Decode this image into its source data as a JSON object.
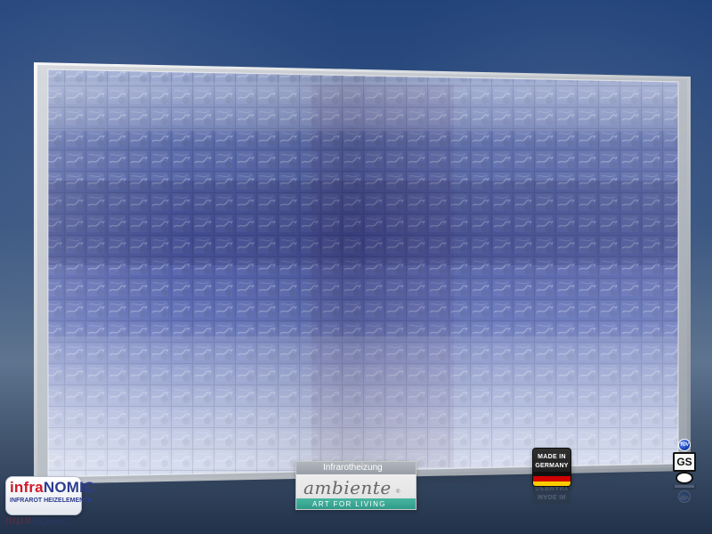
{
  "scene": {
    "subject": "glass-block-panel"
  },
  "badges": {
    "infranomic": {
      "title_lower": "infra",
      "title_upper": "NOMIC",
      "subtitle": "INFRAROT HEIZELEMENTE",
      "colors": {
        "primary": "#2d3d8f",
        "accent": "#d01a2a"
      }
    },
    "ambiente": {
      "heading": "Infrarotheizung",
      "wordmark": "ambiente",
      "registered": "®",
      "tagline": "ART FOR LIVING",
      "colors": {
        "header": "#9ea4ac",
        "band": "#39a895"
      }
    },
    "made_in_germany": {
      "line1": "MADE IN",
      "line2": "GERMANY",
      "flag_colors": [
        "#111111",
        "#d00000",
        "#ffcc00"
      ]
    },
    "gs": {
      "tuv": "TÜV",
      "mark": "GS"
    }
  }
}
